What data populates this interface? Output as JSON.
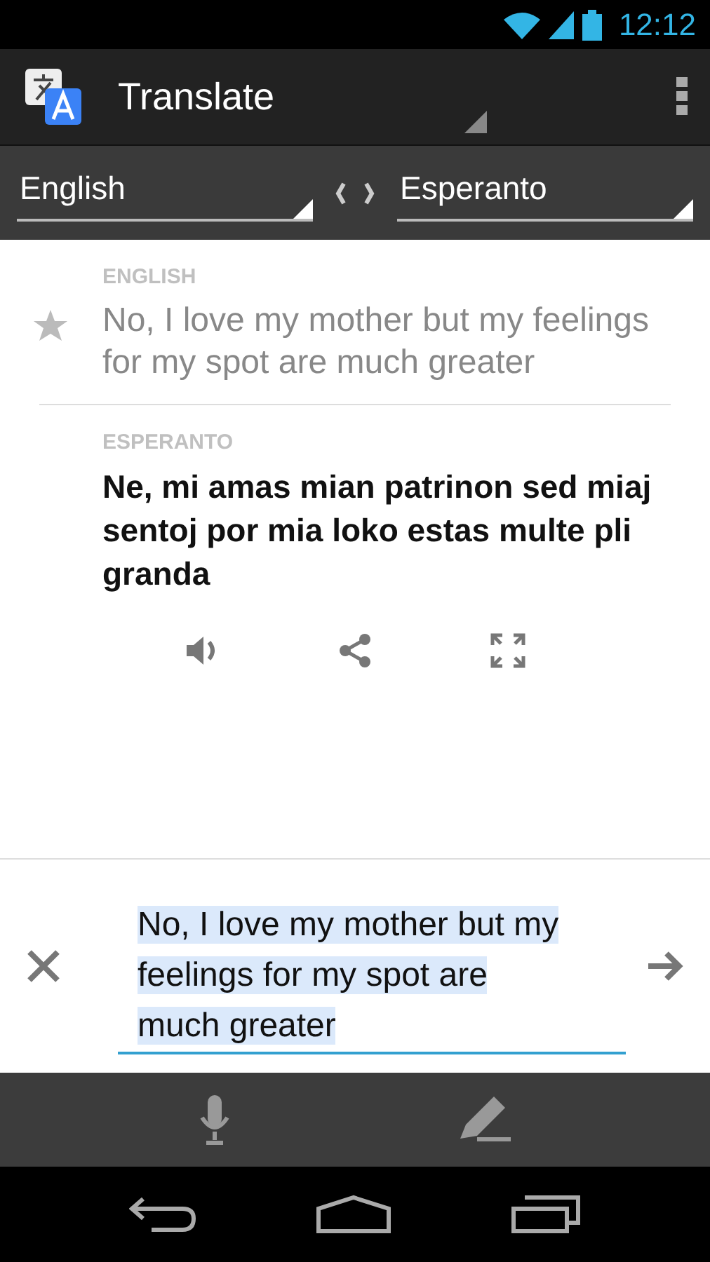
{
  "status_bar": {
    "time": "12:12"
  },
  "action_bar": {
    "title": "Translate"
  },
  "languages": {
    "source": "English",
    "target": "Esperanto"
  },
  "source": {
    "label": "ENGLISH",
    "text": "No, I love my mother but my feelings for my spot are much greater",
    "starred": false
  },
  "result": {
    "label": "ESPERANTO",
    "text": "Ne, mi amas mian patrinon sed miaj sentoj por mia loko estas multe pli granda"
  },
  "input": {
    "value": "No, I love my mother but my feelings for my spot are much greater",
    "text_highlighted": true
  }
}
